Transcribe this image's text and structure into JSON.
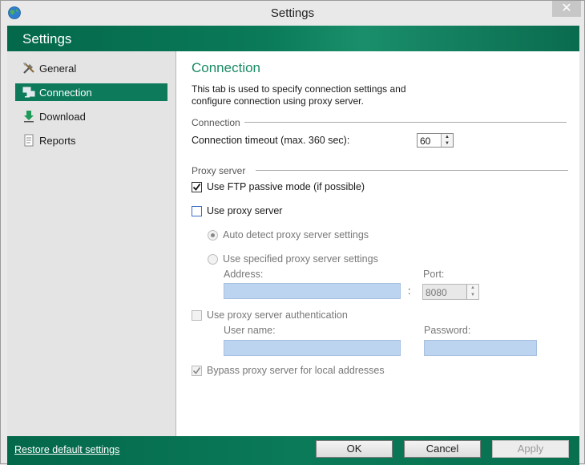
{
  "window": {
    "title": "Settings",
    "close_glyph": "✕"
  },
  "header": {
    "title": "Settings"
  },
  "sidebar": {
    "items": [
      {
        "label": "General",
        "icon": "tools-icon"
      },
      {
        "label": "Connection",
        "icon": "network-icon",
        "active": true
      },
      {
        "label": "Download",
        "icon": "download-icon"
      },
      {
        "label": "Reports",
        "icon": "report-icon"
      }
    ]
  },
  "main": {
    "heading": "Connection",
    "description": "This tab is used to specify connection settings and configure connection using proxy server.",
    "connection_group": "Connection",
    "timeout_label": "Connection timeout (max. 360 sec):",
    "timeout_value": "60",
    "proxy_group": "Proxy server",
    "ftp_passive_label": "Use FTP passive mode (if possible)",
    "ftp_passive_checked": true,
    "use_proxy_label": "Use proxy server",
    "use_proxy_checked": false,
    "auto_detect_label": "Auto detect proxy server settings",
    "use_specified_label": "Use specified proxy server settings",
    "address_label": "Address:",
    "address_value": "",
    "colon": ":",
    "port_label": "Port:",
    "port_value": "8080",
    "auth_label": "Use proxy server authentication",
    "username_label": "User name:",
    "username_value": "",
    "password_label": "Password:",
    "password_value": "",
    "bypass_label": "Bypass proxy server for local addresses",
    "bypass_checked": true
  },
  "footer": {
    "restore_label": "Restore default settings",
    "ok_label": "OK",
    "cancel_label": "Cancel",
    "apply_label": "Apply"
  },
  "colors": {
    "brand_green": "#0c7a5b",
    "heading_green": "#1a8a66",
    "field_blue": "#bdd4f1"
  }
}
